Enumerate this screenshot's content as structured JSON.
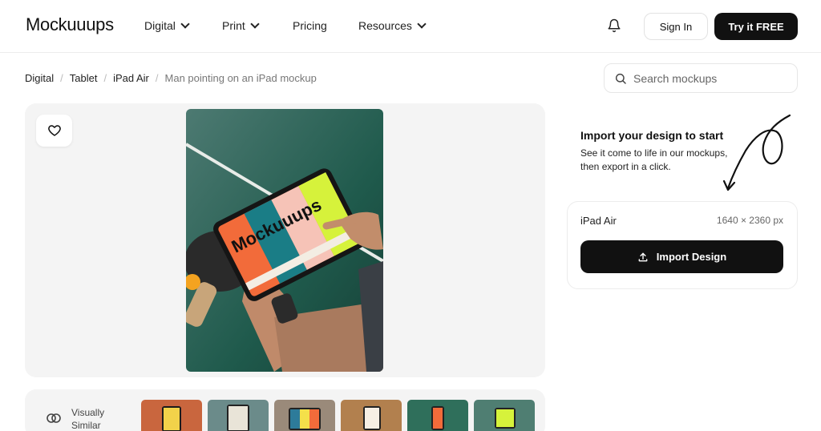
{
  "header": {
    "logo": "Mockuuups",
    "nav": [
      {
        "label": "Digital",
        "has_dropdown": true
      },
      {
        "label": "Print",
        "has_dropdown": true
      },
      {
        "label": "Pricing",
        "has_dropdown": false
      },
      {
        "label": "Resources",
        "has_dropdown": true
      }
    ],
    "notification_icon": "bell-icon",
    "sign_in_label": "Sign In",
    "try_free_label": "Try it FREE"
  },
  "breadcrumb": [
    "Digital",
    "Tablet",
    "iPad Air",
    "Man pointing on an iPad mockup"
  ],
  "search": {
    "placeholder": "Search mockups",
    "value": "",
    "icon": "search-icon"
  },
  "preview": {
    "favorite_icon": "heart-icon",
    "image_alt": "Man pointing on an iPad mockup",
    "screen_text": "Mockuuups",
    "screen_colors": [
      "#f26b3a",
      "#1a7d86",
      "#f6c3b7",
      "#d6f23b"
    ]
  },
  "import": {
    "title": "Import your design to start",
    "description": "See it come to life in our mockups, then export in a click.",
    "device_name": "iPad Air",
    "device_size": "1640 × 2360 px",
    "button_label": "Import Design",
    "button_icon": "upload-icon"
  },
  "similar": {
    "label": "Visually Similar",
    "icon": "overlap-circles-icon",
    "thumbnails": [
      {
        "bg": "#c9663e",
        "screen": "#f2d24a"
      },
      {
        "bg": "#6b8b8a",
        "screen": "#e9e4d8"
      },
      {
        "bg": "#9a8a7a",
        "screen": "#2d7b9a"
      },
      {
        "bg": "#b2804e",
        "screen": "#f6efe4"
      },
      {
        "bg": "#2f6f5b",
        "screen": "#f26b3a"
      },
      {
        "bg": "#4f7e72",
        "screen": "#d6f23b"
      }
    ]
  },
  "colors": {
    "accent_dark": "#111111",
    "panel_bg": "#f4f4f4",
    "border": "#ececec"
  }
}
